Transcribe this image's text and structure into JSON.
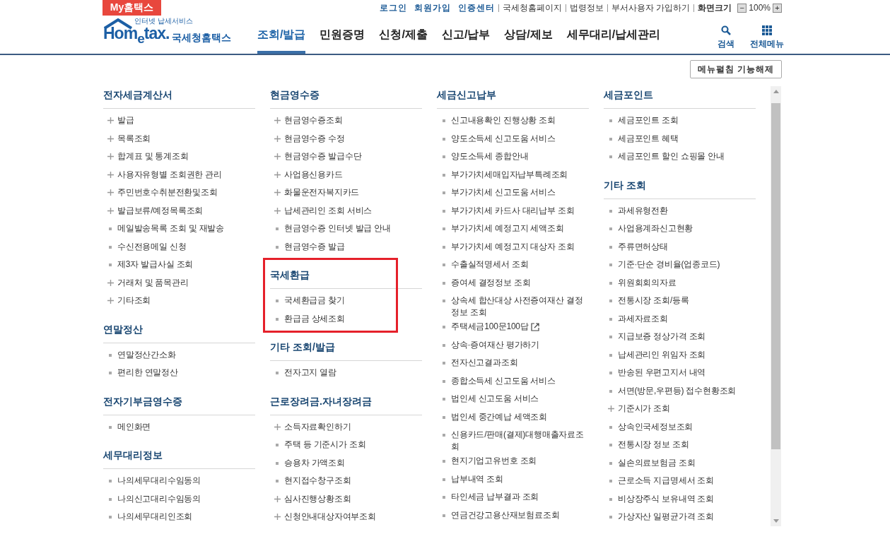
{
  "top_bar": {
    "my_tab": "My홈택스",
    "links": [
      {
        "label": "로그인",
        "kind": "primary"
      },
      {
        "label": "회원가입",
        "kind": "primary"
      },
      {
        "label": "인증센터",
        "kind": "primary"
      },
      {
        "label": "국세청홈페이지",
        "kind": "secondary"
      },
      {
        "label": "법령정보",
        "kind": "secondary"
      },
      {
        "label": "부서사용자 가입하기",
        "kind": "secondary"
      },
      {
        "label": "화면크기",
        "kind": "strong"
      }
    ],
    "zoom": {
      "minus": "−",
      "value": "100%",
      "plus": "+"
    }
  },
  "logo": {
    "tagline": "인터넷 납세서비스",
    "brand": "Hom$_{e}$tax.",
    "name": "국세청홈택스"
  },
  "nav": {
    "tabs": [
      {
        "label": "조회/발급",
        "selected": true
      },
      {
        "label": "민원증명",
        "selected": false
      },
      {
        "label": "신청/제출",
        "selected": false
      },
      {
        "label": "신고/납부",
        "selected": false
      },
      {
        "label": "상담/제보",
        "selected": false
      },
      {
        "label": "세무대리/납세관리",
        "selected": false
      }
    ],
    "search": "검색",
    "all_menu": "전체메뉴"
  },
  "toolbar": {
    "button": "메뉴펼침 기능해제"
  },
  "columns": [
    {
      "sections": [
        {
          "title": "전자세금계산서",
          "highlighted": false,
          "items": [
            {
              "label": "발급",
              "kind": "plus"
            },
            {
              "label": "목록조회",
              "kind": "plus"
            },
            {
              "label": "합계표 및 통계조회",
              "kind": "plus"
            },
            {
              "label": "사용자유형별 조회권한 관리",
              "kind": "plus"
            },
            {
              "label": "주민번호수취분전환및조회",
              "kind": "plus"
            },
            {
              "label": "발급보류/예정목록조회",
              "kind": "plus"
            },
            {
              "label": "메일발송목록 조회 및 재발송",
              "kind": "bullet"
            },
            {
              "label": "수신전용메일 신청",
              "kind": "bullet"
            },
            {
              "label": "제3자 발급사실 조회",
              "kind": "bullet"
            },
            {
              "label": "거래처 및 품목관리",
              "kind": "plus"
            },
            {
              "label": "기타조회",
              "kind": "plus"
            }
          ]
        },
        {
          "title": "연말정산",
          "highlighted": false,
          "items": [
            {
              "label": "연말정산간소화",
              "kind": "bullet"
            },
            {
              "label": "편리한 연말정산",
              "kind": "bullet"
            }
          ]
        },
        {
          "title": "전자기부금영수증",
          "highlighted": false,
          "items": [
            {
              "label": "메인화면",
              "kind": "bullet"
            }
          ]
        },
        {
          "title": "세무대리정보",
          "highlighted": false,
          "items": [
            {
              "label": "나의세무대리수임동의",
              "kind": "bullet"
            },
            {
              "label": "나의신고대리수임동의",
              "kind": "bullet"
            },
            {
              "label": "나의세무대리인조회",
              "kind": "bullet"
            }
          ]
        }
      ]
    },
    {
      "sections": [
        {
          "title": "현금영수증",
          "highlighted": false,
          "items": [
            {
              "label": "현금영수증조회",
              "kind": "plus"
            },
            {
              "label": "현금영수증 수정",
              "kind": "plus"
            },
            {
              "label": "현금영수증 발급수단",
              "kind": "plus"
            },
            {
              "label": "사업용신용카드",
              "kind": "plus"
            },
            {
              "label": "화물운전자복지카드",
              "kind": "plus"
            },
            {
              "label": "납세관리인 조회 서비스",
              "kind": "plus"
            },
            {
              "label": "현금영수증 인터넷 발급 안내",
              "kind": "bullet"
            },
            {
              "label": "현금영수증 발급",
              "kind": "bullet"
            }
          ]
        },
        {
          "title": "국세환급",
          "highlighted": true,
          "items": [
            {
              "label": "국세환급금 찾기",
              "kind": "bullet"
            },
            {
              "label": "환급금 상세조회",
              "kind": "bullet"
            }
          ]
        },
        {
          "title": "기타 조회/발급",
          "highlighted": false,
          "items": [
            {
              "label": "전자고지 열람",
              "kind": "bullet"
            }
          ]
        },
        {
          "title": "근로장려금.자녀장려금",
          "highlighted": false,
          "items": [
            {
              "label": "소득자료확인하기",
              "kind": "plus"
            },
            {
              "label": "주택 등 기준시가 조회",
              "kind": "bullet"
            },
            {
              "label": "승용차 가액조회",
              "kind": "bullet"
            },
            {
              "label": "현지접수창구조회",
              "kind": "bullet"
            },
            {
              "label": "심사진행상황조회",
              "kind": "plus"
            },
            {
              "label": "신청안내대상자여부조회",
              "kind": "plus"
            }
          ]
        }
      ]
    },
    {
      "sections": [
        {
          "title": "세금신고납부",
          "highlighted": false,
          "items": [
            {
              "label": "신고내용확인 진행상황 조회",
              "kind": "bullet"
            },
            {
              "label": "양도소득세 신고도움 서비스",
              "kind": "bullet"
            },
            {
              "label": "양도소득세 종합안내",
              "kind": "bullet"
            },
            {
              "label": "부가가치세매입자납부특례조회",
              "kind": "bullet"
            },
            {
              "label": "부가가치세 신고도움 서비스",
              "kind": "bullet"
            },
            {
              "label": "부가가치세 카드사 대리납부 조회",
              "kind": "bullet"
            },
            {
              "label": "부가가치세 예정고지 세액조회",
              "kind": "bullet"
            },
            {
              "label": "부가가치세 예정고지 대상자 조회",
              "kind": "bullet"
            },
            {
              "label": "수출실적명세서 조회",
              "kind": "bullet"
            },
            {
              "label": "증여세 결정정보 조회",
              "kind": "bullet"
            },
            {
              "label": "상속세 합산대상 사전증여재산 결정정보 조회",
              "kind": "bullet"
            },
            {
              "label": "주택세금100문100답",
              "kind": "link"
            },
            {
              "label": "상속·증여재산 평가하기",
              "kind": "bullet"
            },
            {
              "label": "전자신고결과조회",
              "kind": "bullet"
            },
            {
              "label": "종합소득세 신고도움 서비스",
              "kind": "bullet"
            },
            {
              "label": "법인세 신고도움 서비스",
              "kind": "bullet"
            },
            {
              "label": "법인세 중간예납 세액조회",
              "kind": "bullet"
            },
            {
              "label": "신용카드/판매(결제)대행매출자료조회",
              "kind": "bullet"
            },
            {
              "label": "현지기업고유번호 조회",
              "kind": "bullet"
            },
            {
              "label": "납부내역 조회",
              "kind": "bullet"
            },
            {
              "label": "타인세금 납부결과 조회",
              "kind": "bullet"
            },
            {
              "label": "연금건강고용산재보험료조회",
              "kind": "bullet"
            }
          ]
        }
      ]
    },
    {
      "sections": [
        {
          "title": "세금포인트",
          "highlighted": false,
          "items": [
            {
              "label": "세금포인트 조회",
              "kind": "bullet"
            },
            {
              "label": "세금포인트 혜택",
              "kind": "bullet"
            },
            {
              "label": "세금포인트 할인 쇼핑몰 안내",
              "kind": "bullet"
            }
          ]
        },
        {
          "title": "기타 조회",
          "highlighted": false,
          "items": [
            {
              "label": "과세유형전환",
              "kind": "bullet"
            },
            {
              "label": "사업용계좌신고현황",
              "kind": "bullet"
            },
            {
              "label": "주류면허상태",
              "kind": "bullet"
            },
            {
              "label": "기준·단순 경비율(업종코드)",
              "kind": "bullet"
            },
            {
              "label": "위원회회의자료",
              "kind": "bullet"
            },
            {
              "label": "전통시장 조회/등록",
              "kind": "bullet"
            },
            {
              "label": "과세자료조회",
              "kind": "bullet"
            },
            {
              "label": "지급보증 정상가격 조회",
              "kind": "bullet"
            },
            {
              "label": "납세관리인 위임자 조회",
              "kind": "bullet"
            },
            {
              "label": "반송된 우편고지서 내역",
              "kind": "bullet"
            },
            {
              "label": "서면(방문,우편등) 접수현황조회",
              "kind": "bullet"
            },
            {
              "label": "기준시가 조회",
              "kind": "plus"
            },
            {
              "label": "상속인국세정보조회",
              "kind": "bullet"
            },
            {
              "label": "전통시장 정보 조회",
              "kind": "bullet"
            },
            {
              "label": "실손의료보험금 조회",
              "kind": "bullet"
            },
            {
              "label": "근로소득 지급명세서 조회",
              "kind": "bullet"
            },
            {
              "label": "비상장주식 보유내역 조회",
              "kind": "bullet"
            },
            {
              "label": "가상자산 일평균가격 조회",
              "kind": "bullet"
            }
          ]
        }
      ]
    }
  ]
}
